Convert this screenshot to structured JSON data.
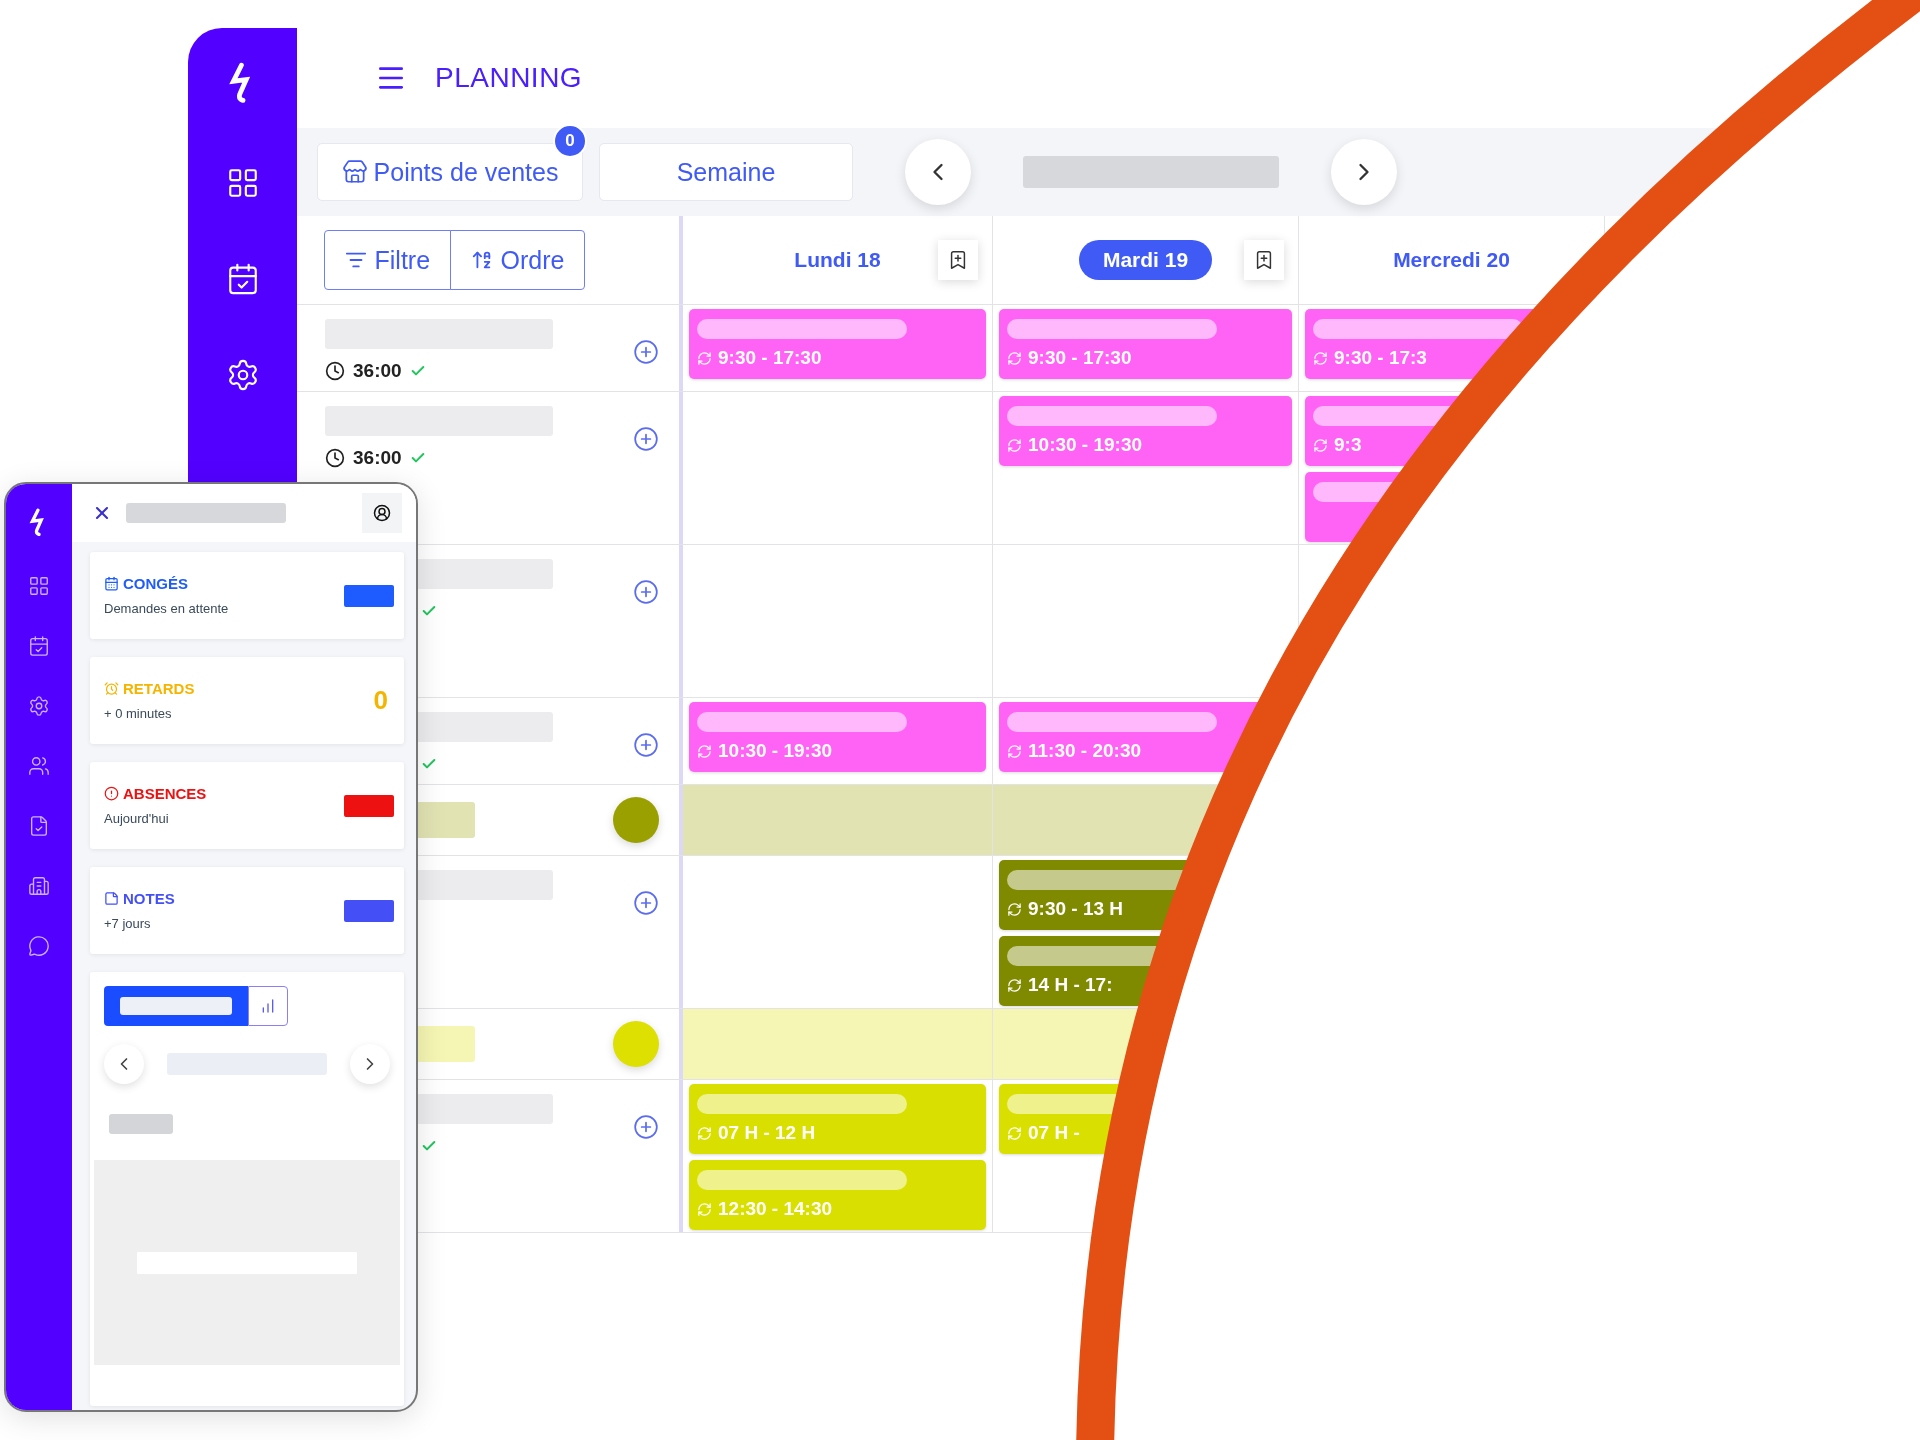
{
  "app": {
    "title": "PLANNING"
  },
  "toolbar": {
    "store_button": {
      "label": "Points de ventes",
      "badge": "0"
    },
    "view_button": {
      "label": "Semaine"
    }
  },
  "sort_buttons": [
    {
      "kind": "filter",
      "label": "Filtre"
    },
    {
      "kind": "sort",
      "label": "Ordre"
    }
  ],
  "days": [
    {
      "label": "Lundi 18",
      "selected": false,
      "bookmark": true
    },
    {
      "label": "Mardi 19",
      "selected": true,
      "bookmark": true
    },
    {
      "label": "Mercredi 20",
      "selected": false,
      "bookmark": false
    }
  ],
  "rows": [
    {
      "kind": "employee",
      "hours": "36:00",
      "validated": true,
      "cells": [
        [
          {
            "time": "9:30 - 17:30",
            "color": "#ff63f5"
          }
        ],
        [
          {
            "time": "9:30 - 17:30",
            "color": "#ff63f5"
          }
        ],
        [
          {
            "time": "9:30 - 17:3",
            "color": "#ff63f5"
          }
        ]
      ]
    },
    {
      "kind": "employee",
      "hours": "36:00",
      "validated": true,
      "cells": [
        [],
        [
          {
            "time": "10:30 - 19:30",
            "color": "#ff63f5"
          }
        ],
        [
          {
            "time": "9:3",
            "color": "#ff63f5"
          },
          {
            "color": "#ff63f5"
          }
        ]
      ]
    },
    {
      "kind": "employee",
      "validated": true,
      "cells": [
        [],
        [],
        []
      ]
    },
    {
      "kind": "employee",
      "validated": true,
      "cells": [
        [
          {
            "time": "10:30 - 19:30",
            "color": "#ff63f5"
          }
        ],
        [
          {
            "time": "11:30 - 20:30",
            "color": "#ff63f5"
          }
        ],
        []
      ]
    },
    {
      "kind": "group",
      "color": "#9aa000"
    },
    {
      "kind": "employee",
      "validated": false,
      "cells": [
        [],
        [
          {
            "time": "9:30 - 13 H",
            "color": "#7f8a00"
          },
          {
            "time": "14 H - 17:",
            "color": "#7f8a00"
          }
        ],
        []
      ]
    },
    {
      "kind": "group",
      "color": "#dde000"
    },
    {
      "kind": "employee",
      "validated": true,
      "cells": [
        [
          {
            "time": "07 H - 12 H",
            "color": "#d9e000"
          },
          {
            "time": "12:30 - 14:30",
            "color": "#d9e000"
          }
        ],
        [
          {
            "time": "07 H -",
            "color": "#d9e000"
          }
        ],
        []
      ]
    }
  ],
  "mobile": {
    "cards": [
      {
        "kind": "leave",
        "title": "CONGÉS",
        "subtitle": "Demandes en attente",
        "color": "#1f5cff"
      },
      {
        "kind": "delay",
        "title": "RETARDS",
        "subtitle": "+ 0 minutes",
        "value": "0",
        "color": "#f5b400"
      },
      {
        "kind": "absence",
        "title": "ABSENCES",
        "subtitle": "Aujourd'hui",
        "color": "#ee1111"
      },
      {
        "kind": "notes",
        "title": "NOTES",
        "subtitle": "+7 jours",
        "color": "#4450f5"
      }
    ]
  }
}
